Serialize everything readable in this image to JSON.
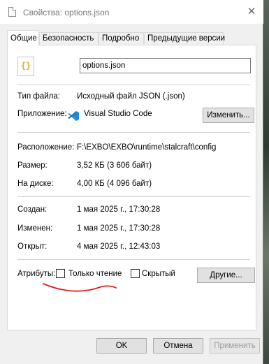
{
  "window": {
    "title": "Свойства: options.json"
  },
  "tabs": [
    {
      "label": "Общие"
    },
    {
      "label": "Безопасность"
    },
    {
      "label": "Подробно"
    },
    {
      "label": "Предыдущие версии"
    }
  ],
  "general": {
    "file_icon_glyph": "{}",
    "file_name": "options.json",
    "type_label": "Тип файла:",
    "type_value": "Исходный файл JSON (.json)",
    "app_label": "Приложение:",
    "app_value": "Visual Studio Code",
    "change_button": "Изменить...",
    "location_label": "Расположение:",
    "location_value": "F:\\EXBO\\EXBO\\runtime\\stalcraft\\config",
    "size_label": "Размер:",
    "size_value": "3,52 КБ (3 606 байт)",
    "disk_label": "На диске:",
    "disk_value": "4,00 КБ (4 096 байт)",
    "created_label": "Создан:",
    "created_value": "1 мая 2025 г., 17:30:28",
    "modified_label": "Изменен:",
    "modified_value": "1 мая 2025 г., 17:30:28",
    "opened_label": "Открыт:",
    "opened_value": "4 мая 2025 г., 12:43:03",
    "attributes_label": "Атрибуты:",
    "readonly_label": "Только чтение",
    "readonly_checked": false,
    "hidden_label": "Скрытый",
    "hidden_checked": false,
    "other_button": "Другие..."
  },
  "footer": {
    "ok": "OK",
    "cancel": "Отмена",
    "apply": "Применить"
  },
  "colors": {
    "annotation_underline": "#e0201f",
    "vscode_blue": "#1f8ad2",
    "json_icon": "#d1b13a"
  }
}
